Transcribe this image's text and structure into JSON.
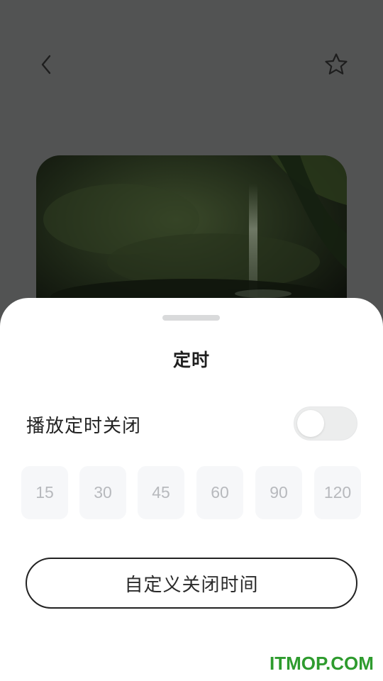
{
  "header": {
    "back_icon": "chevron-left-icon",
    "favorite_icon": "star-outline-icon"
  },
  "cover": {
    "description_icon": "forest-waterfall-image"
  },
  "timer_sheet": {
    "title": "定时",
    "toggle_label": "播放定时关闭",
    "toggle_on": false,
    "options": [
      "15",
      "30",
      "45",
      "60",
      "90",
      "120"
    ],
    "custom_button_label": "自定义关闭时间"
  },
  "watermark": "ITMOP.COM",
  "colors": {
    "overlay_bg": "#525353",
    "sheet_bg": "#ffffff",
    "chip_bg": "#f6f7f9",
    "chip_text": "#b7b9bd",
    "watermark": "#2e9b2e"
  }
}
